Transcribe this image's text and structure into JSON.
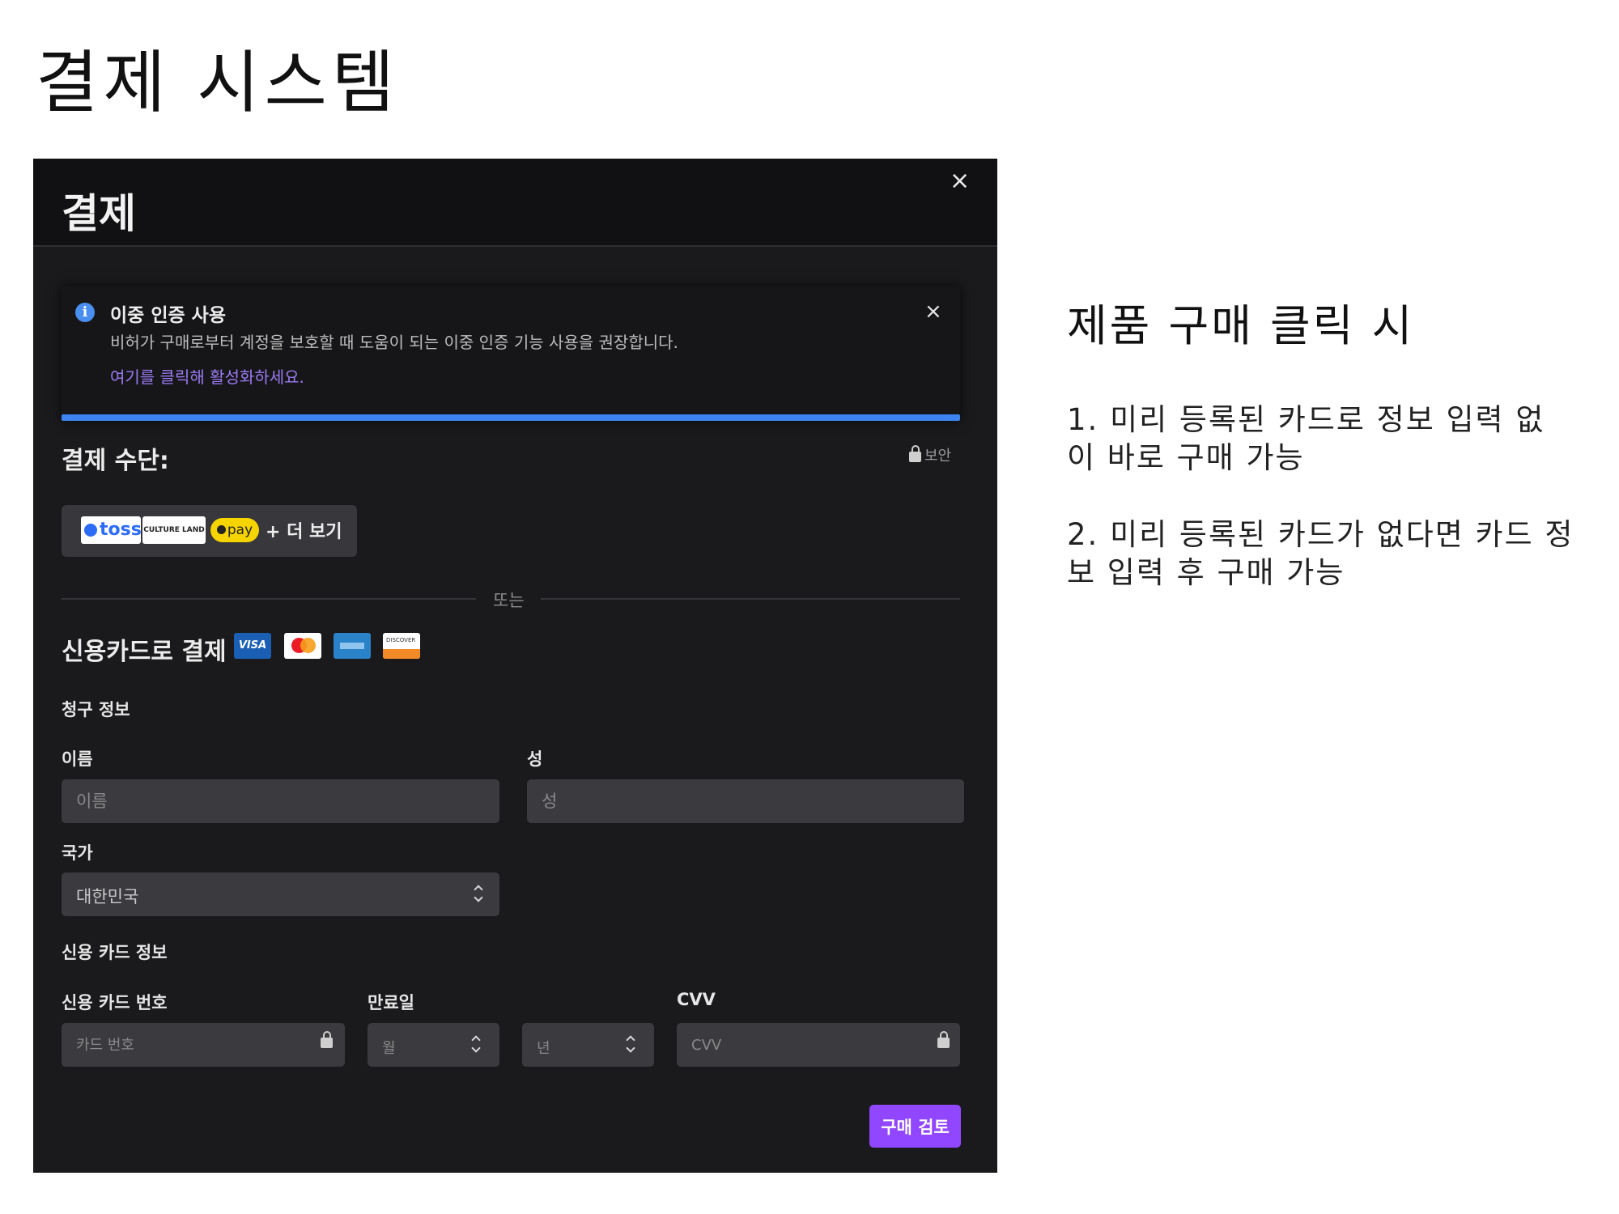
{
  "slide": {
    "title": "결제 시스템"
  },
  "modal": {
    "title": "결제",
    "close_icon": "×"
  },
  "alert": {
    "icon": "i",
    "title": "이중 인증 사용",
    "body": "비허가 구매로부터 계정을 보호할 때 도움이 되는 이중 인증 기능 사용을 권장합니다.",
    "link": "여기를 클릭해 활성화하세요.",
    "close_icon": "×",
    "accent_color": "#3d84f0"
  },
  "payment": {
    "heading": "결제 수단:",
    "secure_label": "보안",
    "methods": {
      "toss": "toss",
      "culture": "CULTURE LAND",
      "kpay": "pay",
      "more": "+ 더 보기"
    },
    "or_text": "또는"
  },
  "card_section": {
    "heading": "신용카드로 결제",
    "brands": [
      "VISA",
      "Mastercard",
      "American Express",
      "DISCOVER"
    ],
    "visa_text": "VISA",
    "discover_text": "DISCOVER"
  },
  "billing": {
    "heading": "청구 정보",
    "first_name_label": "이름",
    "first_name_placeholder": "이름",
    "last_name_label": "성",
    "last_name_placeholder": "성",
    "country_label": "국가",
    "country_value": "대한민국"
  },
  "credit_card": {
    "heading": "신용 카드 정보",
    "number_label": "신용 카드 번호",
    "number_placeholder": "카드 번호",
    "expiry_label": "만료일",
    "month_placeholder": "월",
    "year_placeholder": "년",
    "cvv_label": "CVV",
    "cvv_placeholder": "CVV"
  },
  "buy_button": {
    "label": "구매 검토",
    "color": "#9147ff"
  },
  "notes": {
    "title": "제품 구매 클릭 시",
    "items": [
      "1. 미리 등록된 카드로 정보 입력 없이 바로 구매 가능",
      "2. 미리 등록된 카드가 없다면 카드 정보 입력 후 구매 가능"
    ]
  }
}
